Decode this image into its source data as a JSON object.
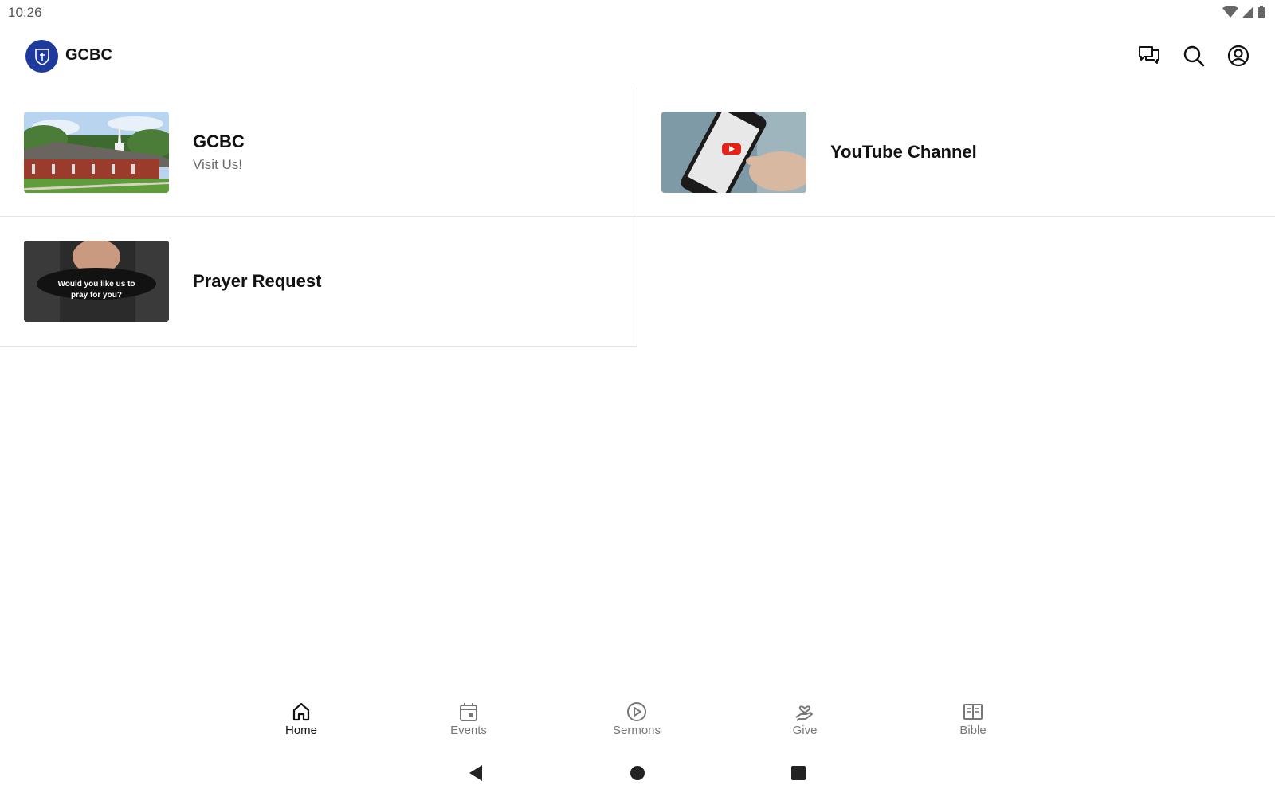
{
  "status_bar": {
    "time": "10:26"
  },
  "app_bar": {
    "title": "GCBC"
  },
  "cards": [
    {
      "title": "GCBC",
      "subtitle": "Visit Us!"
    },
    {
      "title": "YouTube Channel",
      "subtitle": ""
    },
    {
      "title": "Prayer Request",
      "subtitle": "",
      "thumb_caption_line1": "Would you like us to",
      "thumb_caption_line2": "pray for you?"
    }
  ],
  "bottom_nav": {
    "items": [
      {
        "label": "Home",
        "icon": "home-icon",
        "active": true
      },
      {
        "label": "Events",
        "icon": "calendar-icon",
        "active": false
      },
      {
        "label": "Sermons",
        "icon": "play-circle-icon",
        "active": false
      },
      {
        "label": "Give",
        "icon": "give-hand-icon",
        "active": false
      },
      {
        "label": "Bible",
        "icon": "book-open-icon",
        "active": false
      }
    ]
  },
  "colors": {
    "brand": "#1d3a9c",
    "active_nav": "#111111",
    "inactive_nav": "#777777",
    "youtube_red": "#e62117"
  }
}
